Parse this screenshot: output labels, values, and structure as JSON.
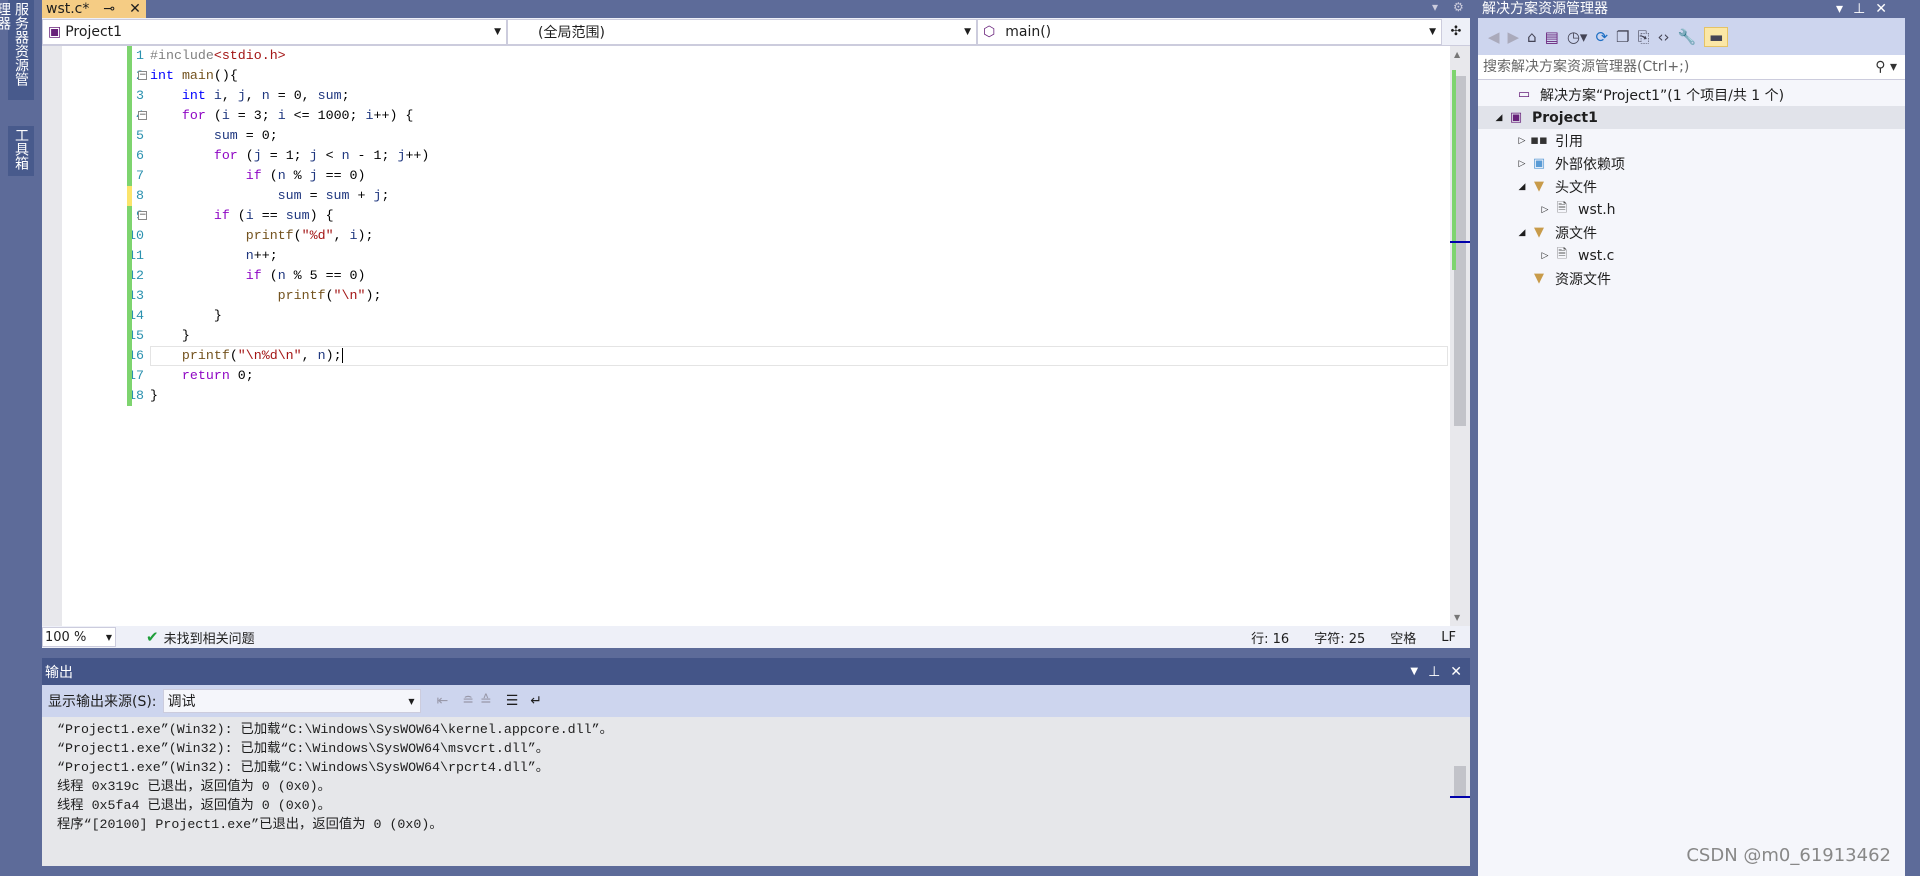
{
  "left_tabs": [
    "服务器资源管理器",
    "工具箱"
  ],
  "doc_tab": {
    "title": "wst.c*",
    "pin_icon": "pin-icon",
    "close_icon": "close-icon"
  },
  "nav": {
    "project": "Project1",
    "scope": "(全局范围)",
    "member": "main()"
  },
  "code": [
    [
      [
        "p",
        "#include"
      ],
      [
        "e",
        "<stdio.h>"
      ]
    ],
    [
      [
        "k",
        "int"
      ],
      [
        "o",
        " "
      ],
      [
        "f",
        "main"
      ],
      [
        "o",
        "(){"
      ]
    ],
    [
      [
        "o",
        "    "
      ],
      [
        "k",
        "int"
      ],
      [
        "o",
        " "
      ],
      [
        "v",
        "i"
      ],
      [
        "o",
        ", "
      ],
      [
        "v",
        "j"
      ],
      [
        "o",
        ", "
      ],
      [
        "v",
        "n"
      ],
      [
        "o",
        " = 0, "
      ],
      [
        "v",
        "sum"
      ],
      [
        "o",
        ";"
      ]
    ],
    [
      [
        "o",
        "    "
      ],
      [
        "c",
        "for"
      ],
      [
        "o",
        " ("
      ],
      [
        "v",
        "i"
      ],
      [
        "o",
        " = 3; "
      ],
      [
        "v",
        "i"
      ],
      [
        "o",
        " <= 1000; "
      ],
      [
        "v",
        "i"
      ],
      [
        "o",
        "++) {"
      ]
    ],
    [
      [
        "o",
        "        "
      ],
      [
        "v",
        "sum"
      ],
      [
        "o",
        " = 0;"
      ]
    ],
    [
      [
        "o",
        "        "
      ],
      [
        "c",
        "for"
      ],
      [
        "o",
        " ("
      ],
      [
        "v",
        "j"
      ],
      [
        "o",
        " = 1; "
      ],
      [
        "v",
        "j"
      ],
      [
        "o",
        " < "
      ],
      [
        "v",
        "n"
      ],
      [
        "o",
        " - 1; "
      ],
      [
        "v",
        "j"
      ],
      [
        "o",
        "++)"
      ]
    ],
    [
      [
        "o",
        "            "
      ],
      [
        "c",
        "if"
      ],
      [
        "o",
        " ("
      ],
      [
        "v",
        "n"
      ],
      [
        "o",
        " % "
      ],
      [
        "v",
        "j"
      ],
      [
        "o",
        " == 0)"
      ]
    ],
    [
      [
        "o",
        "                "
      ],
      [
        "v",
        "sum"
      ],
      [
        "o",
        " = "
      ],
      [
        "v",
        "sum"
      ],
      [
        "o",
        " + "
      ],
      [
        "v",
        "j"
      ],
      [
        "o",
        ";"
      ]
    ],
    [
      [
        "o",
        "        "
      ],
      [
        "c",
        "if"
      ],
      [
        "o",
        " ("
      ],
      [
        "v",
        "i"
      ],
      [
        "o",
        " == "
      ],
      [
        "v",
        "sum"
      ],
      [
        "o",
        ") {"
      ]
    ],
    [
      [
        "o",
        "            "
      ],
      [
        "f",
        "printf"
      ],
      [
        "o",
        "("
      ],
      [
        "s",
        "\"%d\""
      ],
      [
        "o",
        ", "
      ],
      [
        "v",
        "i"
      ],
      [
        "o",
        ");"
      ]
    ],
    [
      [
        "o",
        "            "
      ],
      [
        "v",
        "n"
      ],
      [
        "o",
        "++;"
      ]
    ],
    [
      [
        "o",
        "            "
      ],
      [
        "c",
        "if"
      ],
      [
        "o",
        " ("
      ],
      [
        "v",
        "n"
      ],
      [
        "o",
        " % 5 == 0)"
      ]
    ],
    [
      [
        "o",
        "                "
      ],
      [
        "f",
        "printf"
      ],
      [
        "o",
        "("
      ],
      [
        "s",
        "\"\\n\""
      ],
      [
        "o",
        ");"
      ]
    ],
    [
      [
        "o",
        "        }"
      ]
    ],
    [
      [
        "o",
        "    }"
      ]
    ],
    [
      [
        "o",
        "    "
      ],
      [
        "f",
        "printf"
      ],
      [
        "o",
        "("
      ],
      [
        "s",
        "\"\\n%d\\n\""
      ],
      [
        "o",
        ", "
      ],
      [
        "v",
        "n"
      ],
      [
        "o",
        ");"
      ]
    ],
    [
      [
        "o",
        "    "
      ],
      [
        "c",
        "return"
      ],
      [
        "o",
        " 0;"
      ]
    ],
    [
      [
        "o",
        "}"
      ]
    ]
  ],
  "status": {
    "zoom": "100 %",
    "issues": "未找到相关问题",
    "line": "行: 16",
    "char": "字符: 25",
    "spaces": "空格",
    "eol": "LF"
  },
  "output": {
    "title": "输出",
    "source_label": "显示输出来源(S):",
    "source_value": "调试",
    "lines": [
      "“Project1.exe”(Win32): 已加载“C:\\Windows\\SysWOW64\\kernel.appcore.dll”。",
      "“Project1.exe”(Win32): 已加载“C:\\Windows\\SysWOW64\\msvcrt.dll”。",
      "“Project1.exe”(Win32): 已加载“C:\\Windows\\SysWOW64\\rpcrt4.dll”。",
      "线程 0x319c 已退出，返回值为 0 (0x0)。",
      "线程 0x5fa4 已退出，返回值为 0 (0x0)。",
      "程序“[20100] Project1.exe”已退出，返回值为 0 (0x0)。"
    ]
  },
  "solution_explorer": {
    "title": "解决方案资源管理器",
    "search_placeholder": "搜索解决方案资源管理器(Ctrl+;)",
    "tree": [
      {
        "label": "解决方案“Project1”(1 个项目/共 1 个)",
        "level": 0,
        "twisty": "",
        "icon": "solution-icon"
      },
      {
        "label": "Project1",
        "level": 0,
        "twisty": "expanded",
        "icon": "project-icon",
        "bold": true,
        "selected": true
      },
      {
        "label": "引用",
        "level": 1,
        "twisty": "collapsed",
        "icon": "references-icon"
      },
      {
        "label": "外部依赖项",
        "level": 1,
        "twisty": "collapsed",
        "icon": "external-deps-icon"
      },
      {
        "label": "头文件",
        "level": 1,
        "twisty": "expanded",
        "icon": "filter-folder-icon"
      },
      {
        "label": "wst.h",
        "level": 2,
        "twisty": "collapsed",
        "icon": "header-file-icon"
      },
      {
        "label": "源文件",
        "level": 1,
        "twisty": "expanded",
        "icon": "filter-folder-icon"
      },
      {
        "label": "wst.c",
        "level": 2,
        "twisty": "collapsed",
        "icon": "c-file-icon"
      },
      {
        "label": "资源文件",
        "level": 1,
        "twisty": "",
        "icon": "filter-folder-icon"
      }
    ]
  },
  "watermark": "CSDN @m0_61913462"
}
